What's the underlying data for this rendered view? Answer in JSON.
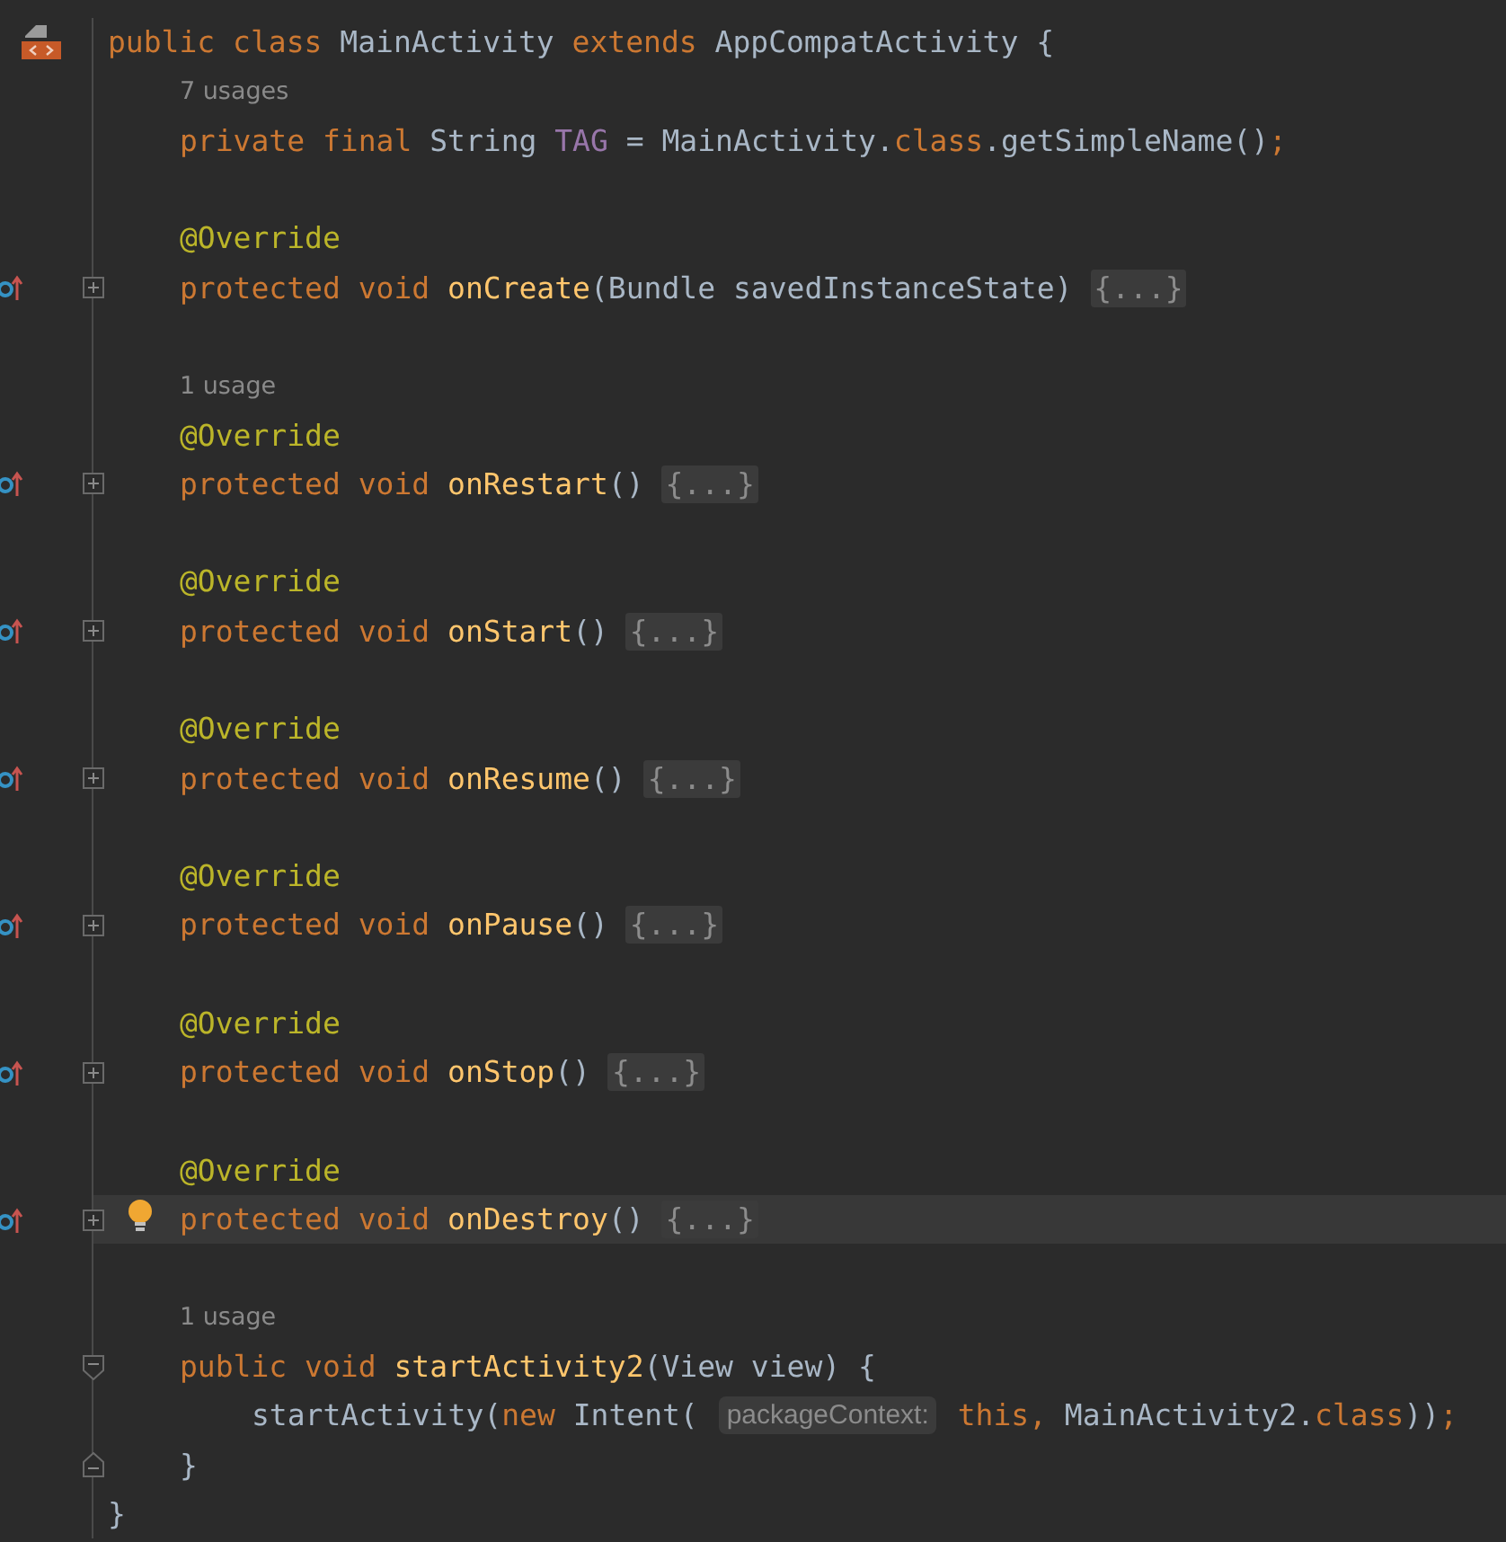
{
  "editor": {
    "lines": [
      {
        "kind": "code",
        "gutter_icon": {
          "kind": "class"
        },
        "current": false,
        "bulb": false,
        "tokens": [
          {
            "kind": "keyword",
            "text": "public class "
          },
          {
            "kind": "plain",
            "text": "MainActivity "
          },
          {
            "kind": "keyword",
            "text": "extends "
          },
          {
            "kind": "plain",
            "text": "AppCompatActivity {"
          }
        ],
        "children": [
          {
            "kind": "hint",
            "text": "7 usages"
          },
          {
            "kind": "code",
            "current": false,
            "bulb": false,
            "tokens": [
              {
                "kind": "keyword",
                "text": "private final "
              },
              {
                "kind": "plain",
                "text": "String "
              },
              {
                "kind": "field",
                "text": "TAG"
              },
              {
                "kind": "plain",
                "text": " = MainActivity."
              },
              {
                "kind": "keyword",
                "text": "class"
              },
              {
                "kind": "plain",
                "text": ".getSimpleName()"
              },
              {
                "kind": "keyword",
                "text": ";"
              }
            ]
          },
          {
            "kind": "blank"
          },
          {
            "kind": "code",
            "current": false,
            "bulb": false,
            "tokens": [
              {
                "kind": "annotation",
                "text": "@Override"
              }
            ]
          },
          {
            "kind": "code",
            "gutter_icon": {
              "kind": "override"
            },
            "fold_icon": {
              "kind": "collapsed"
            },
            "current": false,
            "bulb": false,
            "tokens": [
              {
                "kind": "keyword",
                "text": "protected void "
              },
              {
                "kind": "method",
                "text": "onCreate"
              },
              {
                "kind": "plain",
                "text": "(Bundle savedInstanceState) "
              },
              {
                "kind": "folded",
                "text": "{...}"
              }
            ]
          },
          {
            "kind": "blank"
          },
          {
            "kind": "hint",
            "text": "1 usage"
          },
          {
            "kind": "code",
            "current": false,
            "bulb": false,
            "tokens": [
              {
                "kind": "annotation",
                "text": "@Override"
              }
            ]
          },
          {
            "kind": "code",
            "gutter_icon": {
              "kind": "override"
            },
            "fold_icon": {
              "kind": "collapsed"
            },
            "current": false,
            "bulb": false,
            "tokens": [
              {
                "kind": "keyword",
                "text": "protected void "
              },
              {
                "kind": "method",
                "text": "onRestart"
              },
              {
                "kind": "plain",
                "text": "() "
              },
              {
                "kind": "folded",
                "text": "{...}"
              }
            ]
          },
          {
            "kind": "blank"
          },
          {
            "kind": "code",
            "current": false,
            "bulb": false,
            "tokens": [
              {
                "kind": "annotation",
                "text": "@Override"
              }
            ]
          },
          {
            "kind": "code",
            "gutter_icon": {
              "kind": "override"
            },
            "fold_icon": {
              "kind": "collapsed"
            },
            "current": false,
            "bulb": false,
            "tokens": [
              {
                "kind": "keyword",
                "text": "protected void "
              },
              {
                "kind": "method",
                "text": "onStart"
              },
              {
                "kind": "plain",
                "text": "() "
              },
              {
                "kind": "folded",
                "text": "{...}"
              }
            ]
          },
          {
            "kind": "blank"
          },
          {
            "kind": "code",
            "current": false,
            "bulb": false,
            "tokens": [
              {
                "kind": "annotation",
                "text": "@Override"
              }
            ]
          },
          {
            "kind": "code",
            "gutter_icon": {
              "kind": "override"
            },
            "fold_icon": {
              "kind": "collapsed"
            },
            "current": false,
            "bulb": false,
            "tokens": [
              {
                "kind": "keyword",
                "text": "protected void "
              },
              {
                "kind": "method",
                "text": "onResume"
              },
              {
                "kind": "plain",
                "text": "() "
              },
              {
                "kind": "folded",
                "text": "{...}"
              }
            ]
          },
          {
            "kind": "blank"
          },
          {
            "kind": "code",
            "current": false,
            "bulb": false,
            "tokens": [
              {
                "kind": "annotation",
                "text": "@Override"
              }
            ]
          },
          {
            "kind": "code",
            "gutter_icon": {
              "kind": "override"
            },
            "fold_icon": {
              "kind": "collapsed"
            },
            "current": false,
            "bulb": false,
            "tokens": [
              {
                "kind": "keyword",
                "text": "protected void "
              },
              {
                "kind": "method",
                "text": "onPause"
              },
              {
                "kind": "plain",
                "text": "() "
              },
              {
                "kind": "folded",
                "text": "{...}"
              }
            ]
          },
          {
            "kind": "blank"
          },
          {
            "kind": "code",
            "current": false,
            "bulb": false,
            "tokens": [
              {
                "kind": "annotation",
                "text": "@Override"
              }
            ]
          },
          {
            "kind": "code",
            "gutter_icon": {
              "kind": "override"
            },
            "fold_icon": {
              "kind": "collapsed"
            },
            "current": false,
            "bulb": false,
            "tokens": [
              {
                "kind": "keyword",
                "text": "protected void "
              },
              {
                "kind": "method",
                "text": "onStop"
              },
              {
                "kind": "plain",
                "text": "() "
              },
              {
                "kind": "folded",
                "text": "{...}"
              }
            ]
          },
          {
            "kind": "blank"
          },
          {
            "kind": "code",
            "current": false,
            "bulb": false,
            "tokens": [
              {
                "kind": "annotation",
                "text": "@Override"
              }
            ]
          },
          {
            "kind": "code",
            "gutter_icon": {
              "kind": "override"
            },
            "fold_icon": {
              "kind": "collapsed"
            },
            "current": true,
            "bulb": true,
            "tokens": [
              {
                "kind": "keyword",
                "text": "protected void "
              },
              {
                "kind": "method",
                "text": "onDestroy"
              },
              {
                "kind": "plain",
                "text": "() "
              },
              {
                "kind": "folded",
                "text": "{...}"
              }
            ]
          },
          {
            "kind": "blank"
          },
          {
            "kind": "hint",
            "text": "1 usage"
          },
          {
            "kind": "code",
            "fold_icon": {
              "kind": "open"
            },
            "current": false,
            "bulb": false,
            "tokens": [
              {
                "kind": "keyword",
                "text": "public void "
              },
              {
                "kind": "method",
                "text": "startActivity2"
              },
              {
                "kind": "plain",
                "text": "(View view) {"
              }
            ],
            "children": [
              {
                "kind": "code",
                "current": false,
                "bulb": false,
                "tokens": [
                  {
                    "kind": "plain",
                    "text": "startActivity("
                  },
                  {
                    "kind": "keyword",
                    "text": "new "
                  },
                  {
                    "kind": "plain",
                    "text": "Intent( "
                  },
                  {
                    "kind": "param_hint",
                    "text": "packageContext:"
                  },
                  {
                    "kind": "keyword",
                    "text": " this,"
                  },
                  {
                    "kind": "plain",
                    "text": " MainActivity2."
                  },
                  {
                    "kind": "keyword",
                    "text": "class"
                  },
                  {
                    "kind": "plain",
                    "text": "))"
                  },
                  {
                    "kind": "keyword",
                    "text": ";"
                  }
                ]
              }
            ]
          },
          {
            "kind": "code",
            "fold_icon": {
              "kind": "close"
            },
            "current": false,
            "bulb": false,
            "tokens": [
              {
                "kind": "plain",
                "text": "}"
              }
            ]
          }
        ]
      },
      {
        "kind": "code",
        "current": false,
        "bulb": false,
        "tokens": [
          {
            "kind": "plain",
            "text": "}"
          }
        ]
      }
    ]
  }
}
